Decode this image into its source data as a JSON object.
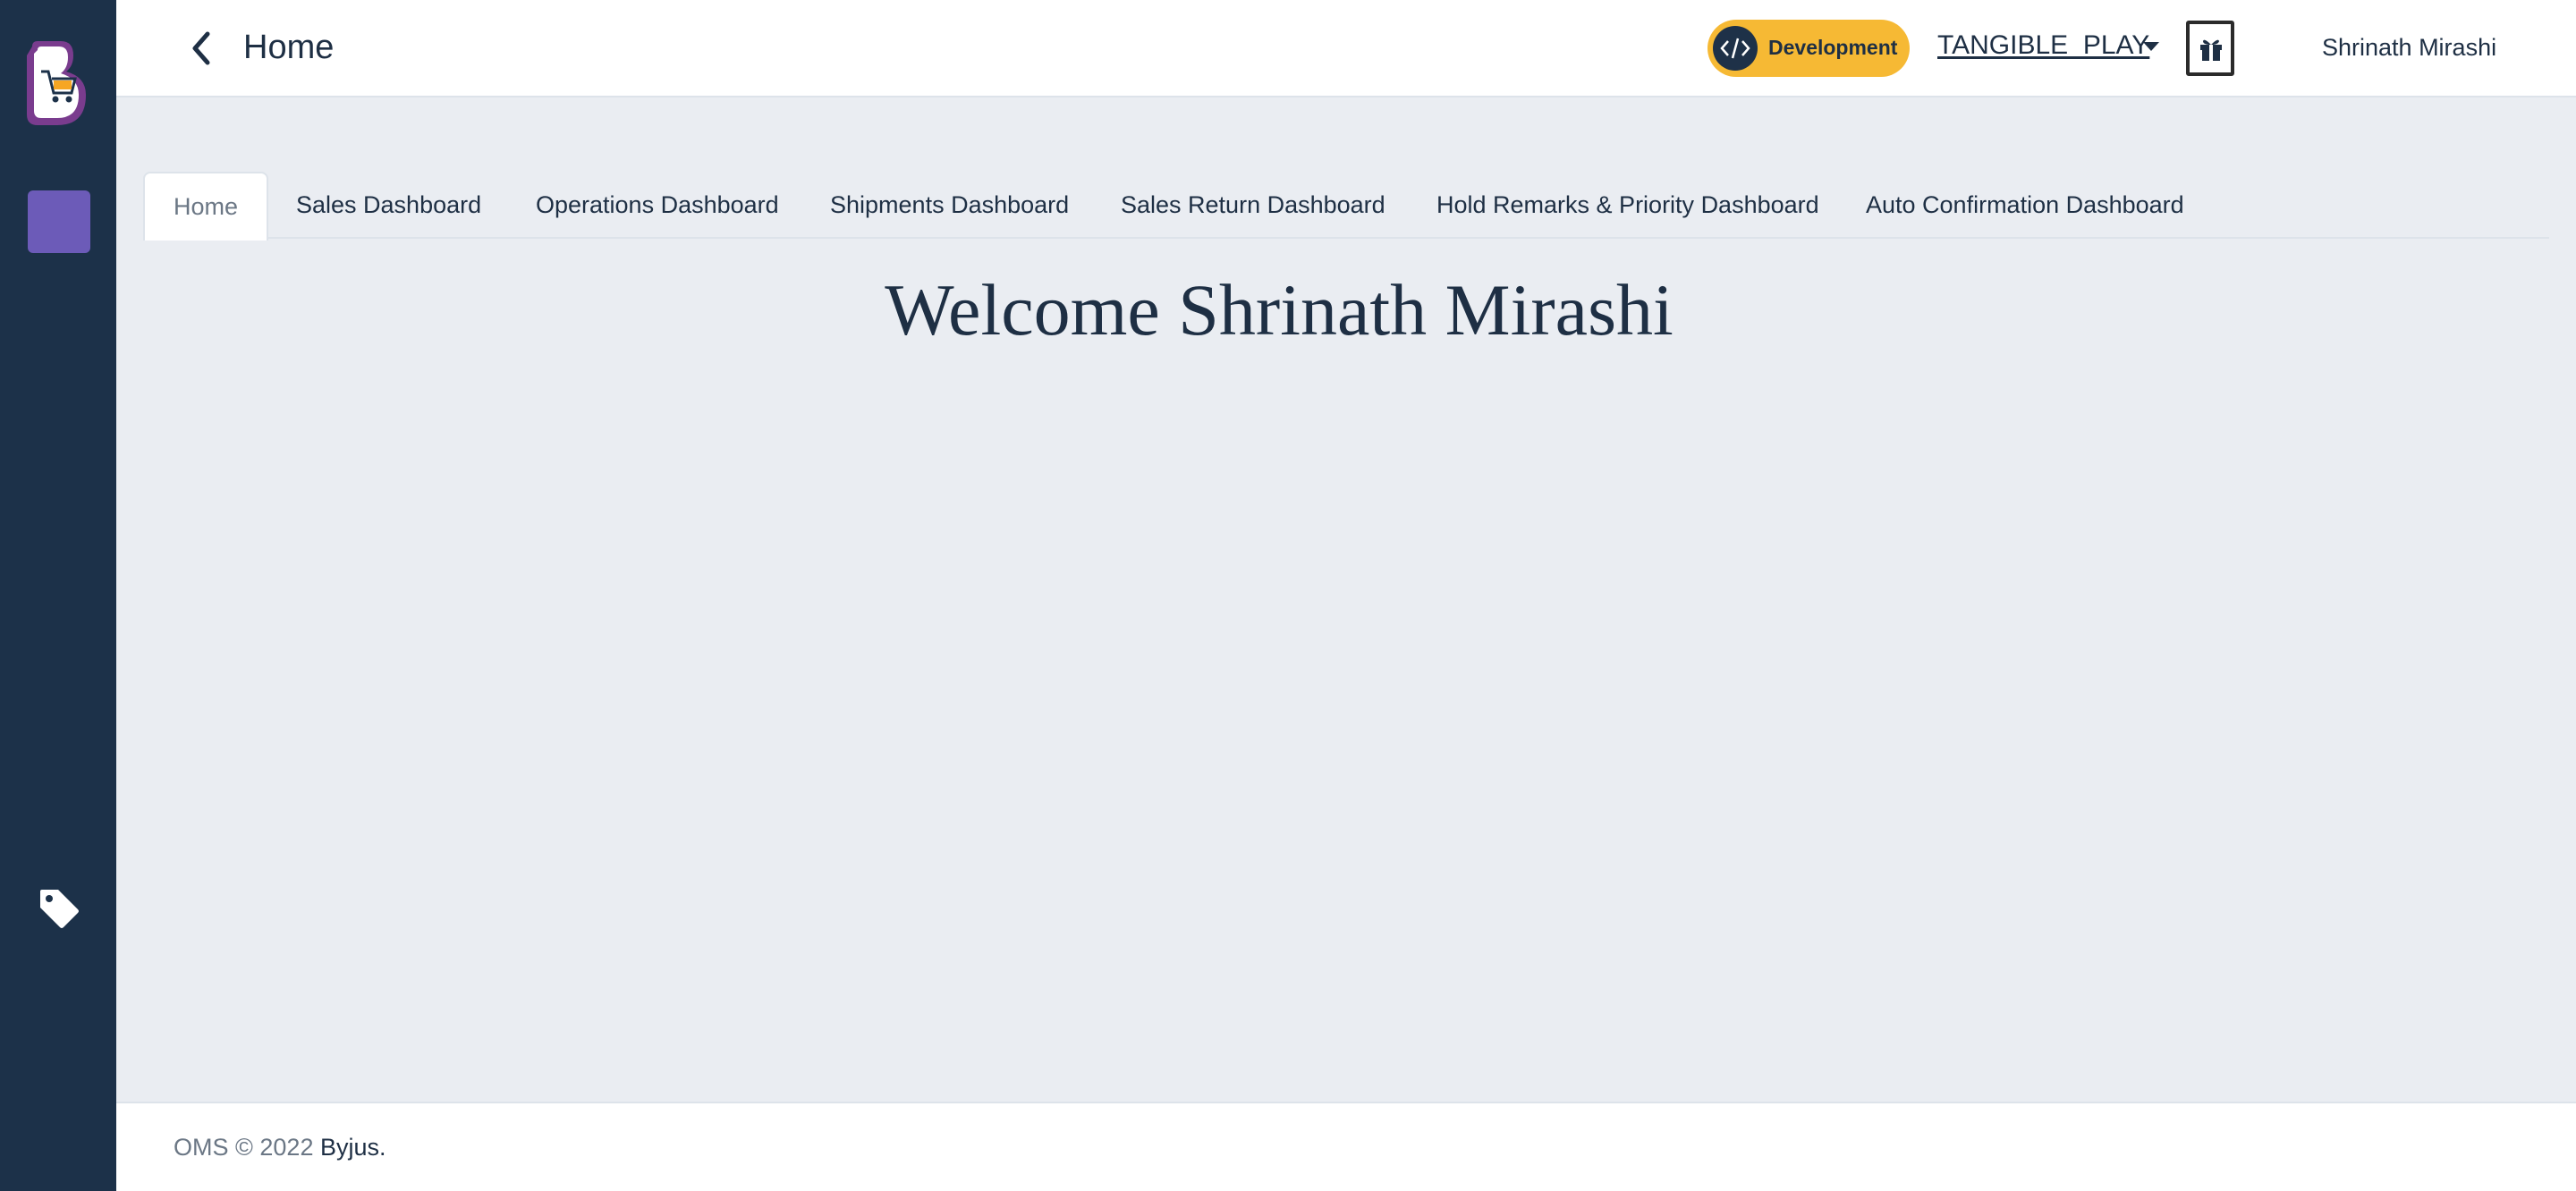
{
  "header": {
    "title": "Home",
    "environment": "Development",
    "organization": "TANGIBLE_PLAY",
    "user": "Shrinath Mirashi"
  },
  "tabs": [
    {
      "label": "Home",
      "active": true
    },
    {
      "label": "Sales Dashboard",
      "active": false
    },
    {
      "label": "Operations Dashboard",
      "active": false
    },
    {
      "label": "Shipments Dashboard",
      "active": false
    },
    {
      "label": "Sales Return Dashboard",
      "active": false
    },
    {
      "label": "Hold Remarks & Priority Dashboard",
      "active": false
    },
    {
      "label": "Auto Confirmation Dashboard",
      "active": false
    }
  ],
  "main": {
    "welcome": "Welcome Shrinath Mirashi"
  },
  "footer": {
    "copyright": "OMS © 2022",
    "brand": "Byjus."
  },
  "icons": {
    "logo": "cart-logo-icon",
    "back": "chevron-left-icon",
    "env": "code-icon",
    "gift": "gift-icon",
    "tag": "tag-icon"
  },
  "colors": {
    "sidebar": "#1c3149",
    "accent": "#6c5bb8",
    "env_badge": "#f6b934",
    "background": "#eaedf2"
  }
}
